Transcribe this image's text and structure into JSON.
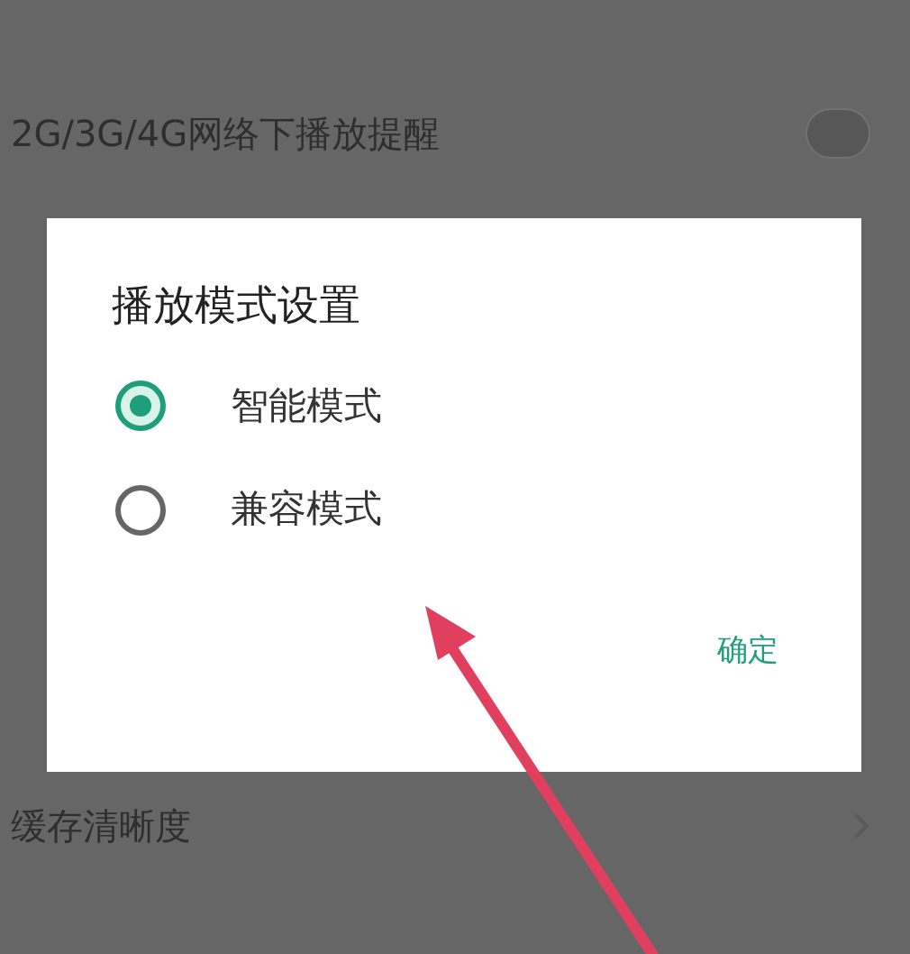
{
  "settings_rows": [
    {
      "label": "2G/3G/4G网络下播放提醒",
      "kind": "toggle",
      "on": false
    },
    {
      "label": "缓存清晰度",
      "kind": "link"
    }
  ],
  "dialog": {
    "title": "播放模式设置",
    "options": [
      {
        "label": "智能模式",
        "selected": true
      },
      {
        "label": "兼容模式",
        "selected": false
      }
    ],
    "confirm": "确定"
  }
}
